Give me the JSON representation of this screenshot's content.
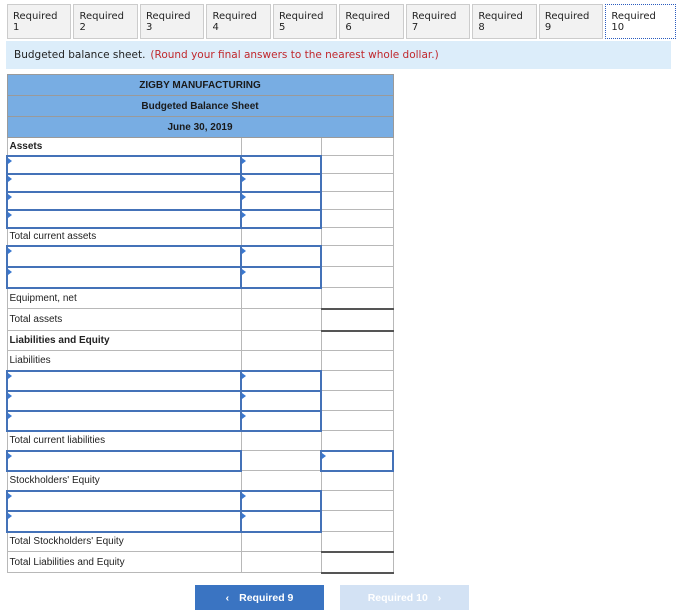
{
  "tabs": [
    "Required 1",
    "Required 2",
    "Required 3",
    "Required 4",
    "Required 5",
    "Required 6",
    "Required 7",
    "Required 8",
    "Required 9",
    "Required 10"
  ],
  "active_tab": "Required 10",
  "instruction": {
    "text": "Budgeted balance sheet.",
    "note": "(Round your final answers to the nearest whole dollar.)"
  },
  "sheet": {
    "company": "ZIGBY MANUFACTURING",
    "title": "Budgeted Balance Sheet",
    "date": "June 30, 2019",
    "labels": {
      "assets": "Assets",
      "total_current_assets": "Total current assets",
      "equipment": "Equipment, net",
      "total_assets": "Total assets",
      "liab_equity": "Liabilities and Equity",
      "liabilities": "Liabilities",
      "total_current_liabilities": "Total current liabilities",
      "stockholders_equity": "Stockholders' Equity",
      "total_se": "Total Stockholders' Equity",
      "total_le": "Total Liabilities and Equity"
    }
  },
  "nav": {
    "prev": "Required 9",
    "next": "Required 10",
    "prev_icon": "chevron-left-icon",
    "next_icon": "chevron-right-icon"
  }
}
